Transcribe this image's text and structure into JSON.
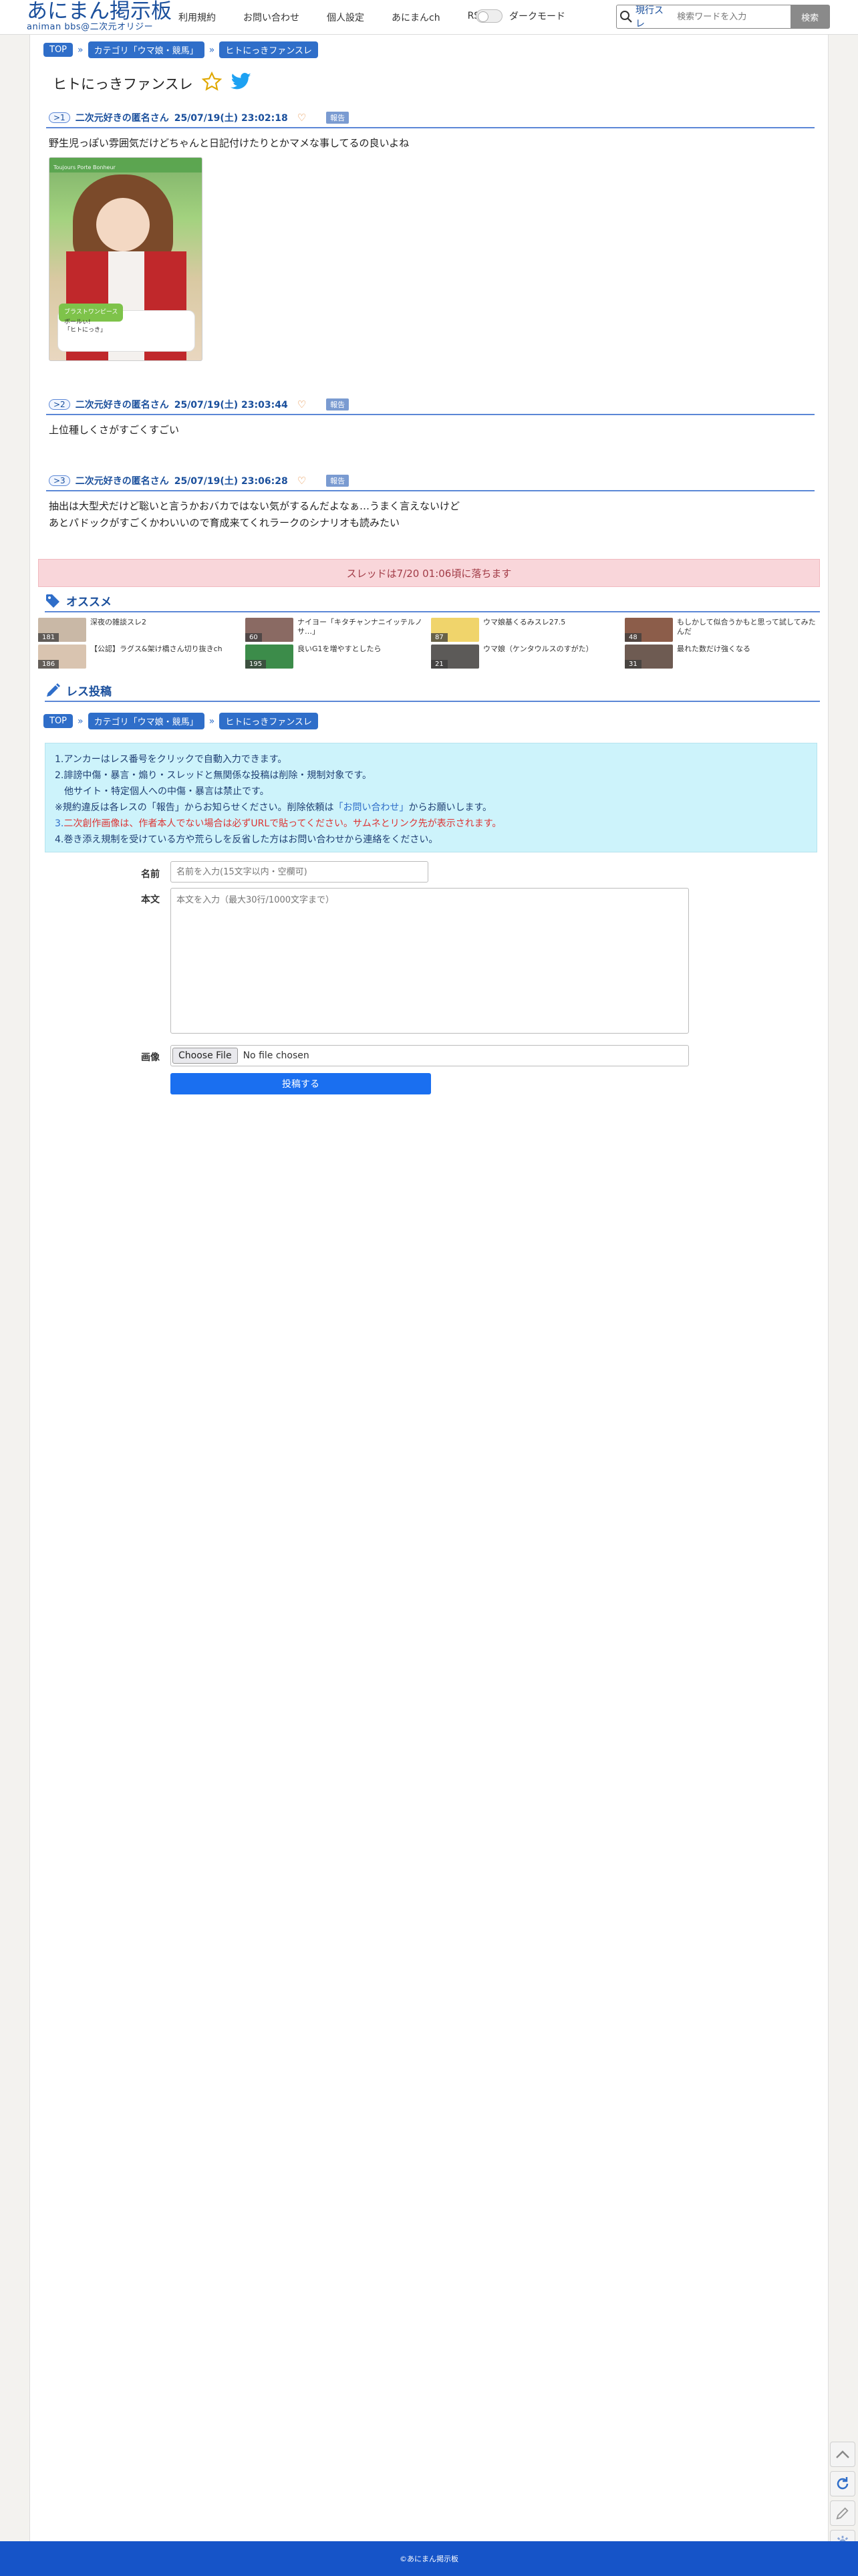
{
  "header": {
    "logo_title": "あにまん掲示板",
    "logo_subtitle": "animan bbs@二次元オリジー",
    "nav": [
      "利用規約",
      "お問い合わせ",
      "個人設定",
      "あにまんch",
      "RSS"
    ],
    "darkmode_label": "ダークモード",
    "search": {
      "scope_label": "現行スレ",
      "placeholder": "検索ワードを入力",
      "button_label": "検索"
    }
  },
  "breadcrumb": [
    "TOP",
    "カテゴリ「ウマ娘・競馬」",
    "ヒトにっきファンスレ"
  ],
  "thread": {
    "title": "ヒトにっきファンスレ"
  },
  "posts": [
    {
      "no": ">1",
      "name": "二次元好きの匿名さん",
      "date": "25/07/19(土) 23:02:18",
      "report": "報告",
      "body": [
        "野生児っぽい雰囲気だけどちゃんと日記付けたりとかマメな事してるの良いよね"
      ],
      "image": {
        "banner": "Toujours Porte Bonheur",
        "tag": "ブラストワンピース",
        "lines": [
          "ボールぃ!",
          "「ヒトにっき」"
        ]
      }
    },
    {
      "no": ">2",
      "name": "二次元好きの匿名さん",
      "date": "25/07/19(土) 23:03:44",
      "report": "報告",
      "body": [
        "上位種しくさがすごくすごい"
      ]
    },
    {
      "no": ">3",
      "name": "二次元好きの匿名さん",
      "date": "25/07/19(土) 23:06:28",
      "report": "報告",
      "body": [
        "抽出は大型犬だけど聡いと言うかおバカではない気がするんだよなぁ…うまく言えないけど",
        "あとパドックがすごくかわいいので育成来てくれラークのシナリオも読みたい"
      ]
    }
  ],
  "expire_notice": "スレッドは7/20 01:06頃に落ちます",
  "recommend": {
    "title": "オススメ",
    "items": [
      {
        "title": "深夜の雑談スレ2",
        "count": "181",
        "color": "#c9b8a6"
      },
      {
        "title": "ナイヨー「キタチャンナニイッテルノサ…」",
        "count": "60",
        "color": "#8a6a63"
      },
      {
        "title": "ウマ娘基くるみスレ27.5",
        "count": "87",
        "color": "#f0d46b"
      },
      {
        "title": "もしかして似合うかもと思って試してみたんだ",
        "count": "48",
        "color": "#8c5d4a"
      },
      {
        "title": "【公認】ラグス&架け橋さん切り抜きch",
        "count": "186",
        "color": "#d9c4b0"
      },
      {
        "title": "良いG1を増やすとしたら",
        "count": "195",
        "color": "#3c8c4a"
      },
      {
        "title": "ウマ娘（ケンタウルスのすがた）",
        "count": "21",
        "color": "#5c5a58"
      },
      {
        "title": "最れた数だけ強くなる",
        "count": "31",
        "color": "#6e5b52"
      }
    ]
  },
  "post_form": {
    "title": "レス投稿",
    "rules": [
      "1.アンカーはレス番号をクリックで自動入力できます。",
      "2.誹謗中傷・暴言・煽り・スレッドと無関係な投稿は削除・規制対象です。",
      "　他サイト・特定個人への中傷・暴言は禁止です。",
      "※規約違反は各レスの「報告」からお知らせください。削除依頼は",
      "「お問い合わせ」",
      "からお願いします。",
      "3.",
      "二次創作画像は、作者本人でない場合は必ずURLで貼ってください。サムネとリンク先が表示されます。",
      "4.巻き添え規制を受けている方や荒らしを反省した方はお問い合わせから連絡をください。"
    ],
    "name_label": "名前",
    "name_placeholder": "名前を入力(15文字以内・空欄可)",
    "body_label": "本文",
    "body_placeholder": "本文を入力（最大30行/1000文字まで）",
    "image_label": "画像",
    "file_button": "Choose File",
    "file_status": "No file chosen",
    "submit_label": "投稿する"
  },
  "footer": {
    "copyright": "©あにまん掲示板"
  }
}
